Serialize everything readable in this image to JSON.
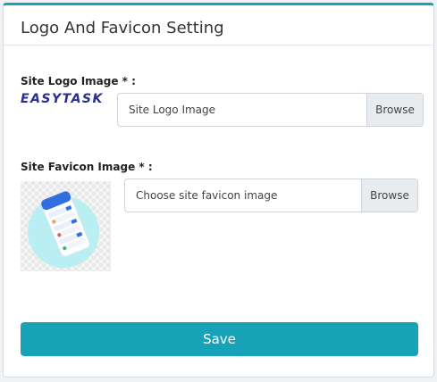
{
  "header": {
    "title": "Logo And Favicon Setting"
  },
  "logo": {
    "label": "Site Logo Image * :",
    "brand_text": "EASYTASK",
    "input_placeholder": "Site Logo Image",
    "browse_label": "Browse"
  },
  "favicon": {
    "label": "Site Favicon Image * :",
    "input_placeholder": "Choose site favicon image",
    "browse_label": "Browse"
  },
  "actions": {
    "save_label": "Save"
  },
  "colors": {
    "accent": "#17a2b8",
    "brand": "#2a2f8f"
  }
}
